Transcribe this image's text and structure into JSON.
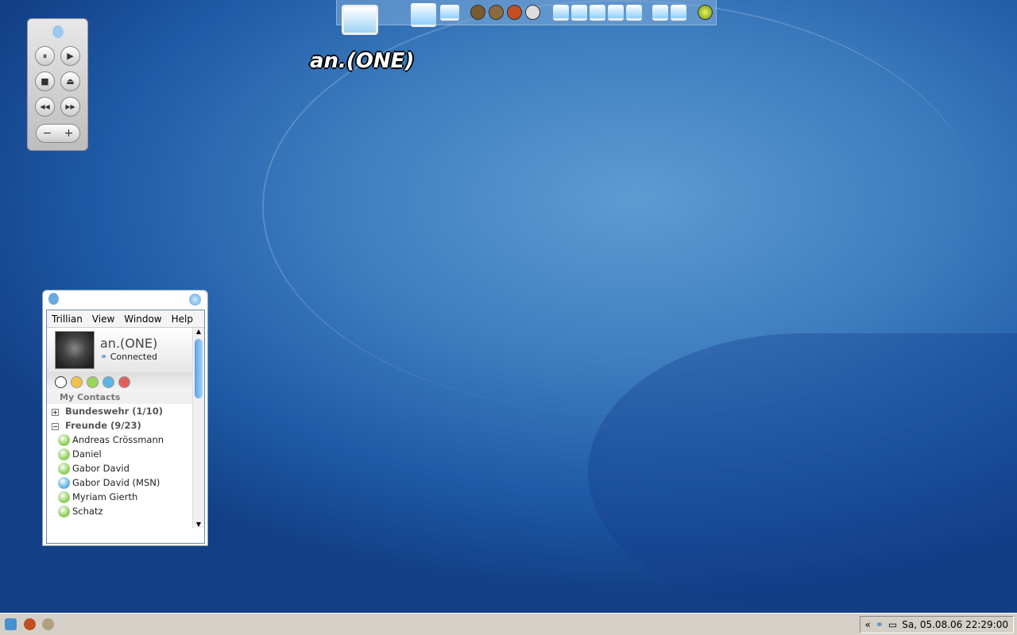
{
  "desktop": {
    "icon_label": "an.(ONE)"
  },
  "media": {
    "buttons": [
      "⏸",
      "▶",
      "■",
      "⏏",
      "◀◀",
      "▶▶"
    ],
    "vol_minus": "−",
    "vol_plus": "+"
  },
  "trillian": {
    "menu": [
      "Trillian",
      "View",
      "Window",
      "Help"
    ],
    "profile": {
      "name": "an.(ONE)",
      "status": "Connected"
    },
    "contacts_header": "My Contacts",
    "groups": [
      {
        "name": "Bundeswehr (1/10)",
        "expanded": false
      },
      {
        "name": "Freunde (9/23)",
        "expanded": true
      }
    ],
    "contacts": [
      {
        "name": "Andreas Crössmann",
        "color": "#8fcf5a"
      },
      {
        "name": "Daniel",
        "color": "#8fcf5a"
      },
      {
        "name": "Gabor David",
        "color": "#8fcf5a"
      },
      {
        "name": "Gabor David (MSN)",
        "color": "#5fb2e6"
      },
      {
        "name": "Myriam Gierth",
        "color": "#8fcf5a"
      },
      {
        "name": "Schatz",
        "color": "#8fcf5a"
      }
    ]
  },
  "taskbar": {
    "tray_expand": "«",
    "clock": "Sa, 05.08.06 22:29:00"
  }
}
